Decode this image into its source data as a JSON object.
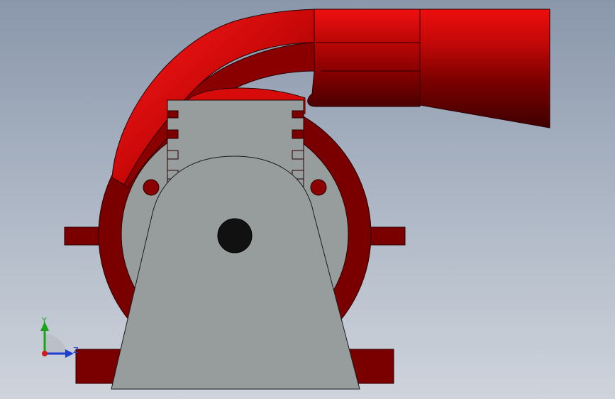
{
  "viewport": {
    "background_top": "#8a97ab",
    "background_bottom": "#cfd4dc"
  },
  "model": {
    "housing_color": "#7a0000",
    "housing_highlight": "#e80d0d",
    "bracket_color": "#979c9d",
    "shaft_color": "#111111"
  },
  "triad": {
    "y_label": "Y",
    "z_label": "Z",
    "y_color": "#1aa31a",
    "z_color": "#1f3fcf",
    "x_color": "#d11a1a"
  }
}
